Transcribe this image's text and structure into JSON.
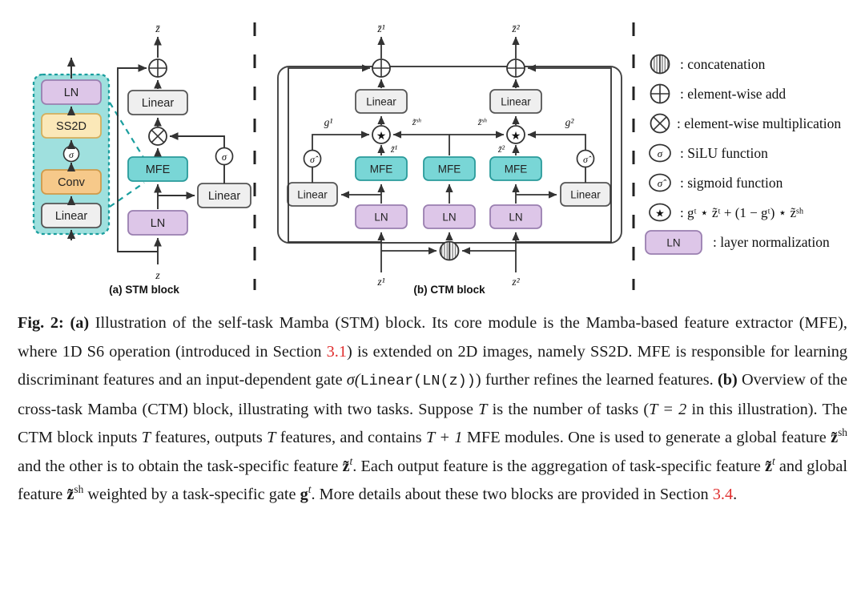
{
  "figure": {
    "panel_a": {
      "caption": "(a) STM block",
      "input_label": "z",
      "output_label": "z̄",
      "expanded_mfe": {
        "blocks": [
          "LN",
          "SS2D",
          "Conv",
          "Linear"
        ],
        "sigma_label": "σ",
        "dash_color": "#1a9e9e",
        "fill_color": "#9fe0de"
      },
      "blocks": [
        "Linear",
        "MFE",
        "LN",
        "Linear"
      ],
      "sigma_label": "σ",
      "ops": [
        "add",
        "multiply"
      ]
    },
    "panel_b": {
      "caption": "(b) CTM block",
      "inputs": [
        "z¹",
        "z²"
      ],
      "outputs": [
        "z̄¹",
        "z̄²"
      ],
      "gate_labels": [
        "g¹",
        "g²"
      ],
      "shared_labels": [
        "z̃ˢʰ",
        "z̃ˢʰ"
      ],
      "task_labels": [
        "z̃¹",
        "z̃²"
      ],
      "mfe_label": "MFE",
      "ln_label": "LN",
      "linear_label": "Linear",
      "sigmahat_label": "σ̂",
      "mfe_count": 3,
      "ln_count": 3
    },
    "legend": [
      {
        "icon": "concatenation-icon",
        "text": ": concatenation"
      },
      {
        "icon": "element-wise-add-icon",
        "text": ": element-wise add"
      },
      {
        "icon": "element-wise-multiplication-icon",
        "text": ": element-wise multiplication"
      },
      {
        "icon": "silu-function-icon",
        "symbol": "σ",
        "text": ": SiLU function"
      },
      {
        "icon": "sigmoid-function-icon",
        "symbol": "σ̂",
        "text": ": sigmoid function"
      },
      {
        "icon": "star-aggregation-icon",
        "text": ": gᵗ ⋆ z̃ᵗ + (1 − gᵗ) ⋆ z̃ˢʰ"
      },
      {
        "icon": "ln-swatch-icon",
        "symbol": "LN",
        "text": ": layer normalization"
      }
    ],
    "colors": {
      "ln_fill": "#ddc6e8",
      "ln_stroke": "#9a7fb0",
      "mfe_fill": "#79d6d6",
      "mfe_stroke": "#2a9b9b",
      "ss2d_fill": "#fbe8b8",
      "ss2d_stroke": "#d4ae5c",
      "conv_fill": "#f6c98a",
      "conv_stroke": "#cf9a4a",
      "linear_fill": "#efefef",
      "linear_stroke": "#555555",
      "dash_separator": "#222222",
      "link_red": "#e03030"
    }
  },
  "caption": {
    "label": "Fig. 2:",
    "a_tag": "(a)",
    "b_tag": "(b)",
    "t1": " Illustration of the self-task Mamba (STM) block. Its core module is the Mamba-based feature extractor (MFE), where 1D S6 operation (introduced in Section ",
    "ref1": "3.1",
    "t2": ") is extended on 2D images, namely SS2D. MFE is responsible for learning discriminant features and an input-dependent gate ",
    "gate_formula_sigma": "σ(",
    "gate_formula_mono": "Linear(LN(z))",
    "gate_formula_close": ")",
    "t3": " further refines the learned features. ",
    "t4": " Overview of the cross-task Mamba (CTM) block, illustrating with two tasks. Suppose ",
    "T1": "T",
    "t5": " is the number of tasks (",
    "T_eq": "T = 2",
    "t6": " in this illustration). The CTM block inputs ",
    "T2": "T",
    "t7": " features, outputs ",
    "T3": "T",
    "t8": " features, and contains ",
    "T4": "T + 1",
    "t9": " MFE modules. One is used to generate a global feature ",
    "zsh1": "z̃",
    "zsh1_sup": "sh",
    "t10": " and the other is to obtain the task-specific feature ",
    "zt1": "z̃",
    "zt1_sup": "t",
    "t11": ". Each output feature is the aggregation of task-specific feature ",
    "zt2": "z̃",
    "zt2_sup": "t",
    "t12": " and global feature ",
    "zsh2": "z̃",
    "zsh2_sup": "sh",
    "t13": " weighted by a task-specific gate ",
    "gt": "g",
    "gt_sup": "t",
    "t14": ". More details about these two blocks are provided in Section ",
    "ref2": "3.4",
    "t15": "."
  }
}
